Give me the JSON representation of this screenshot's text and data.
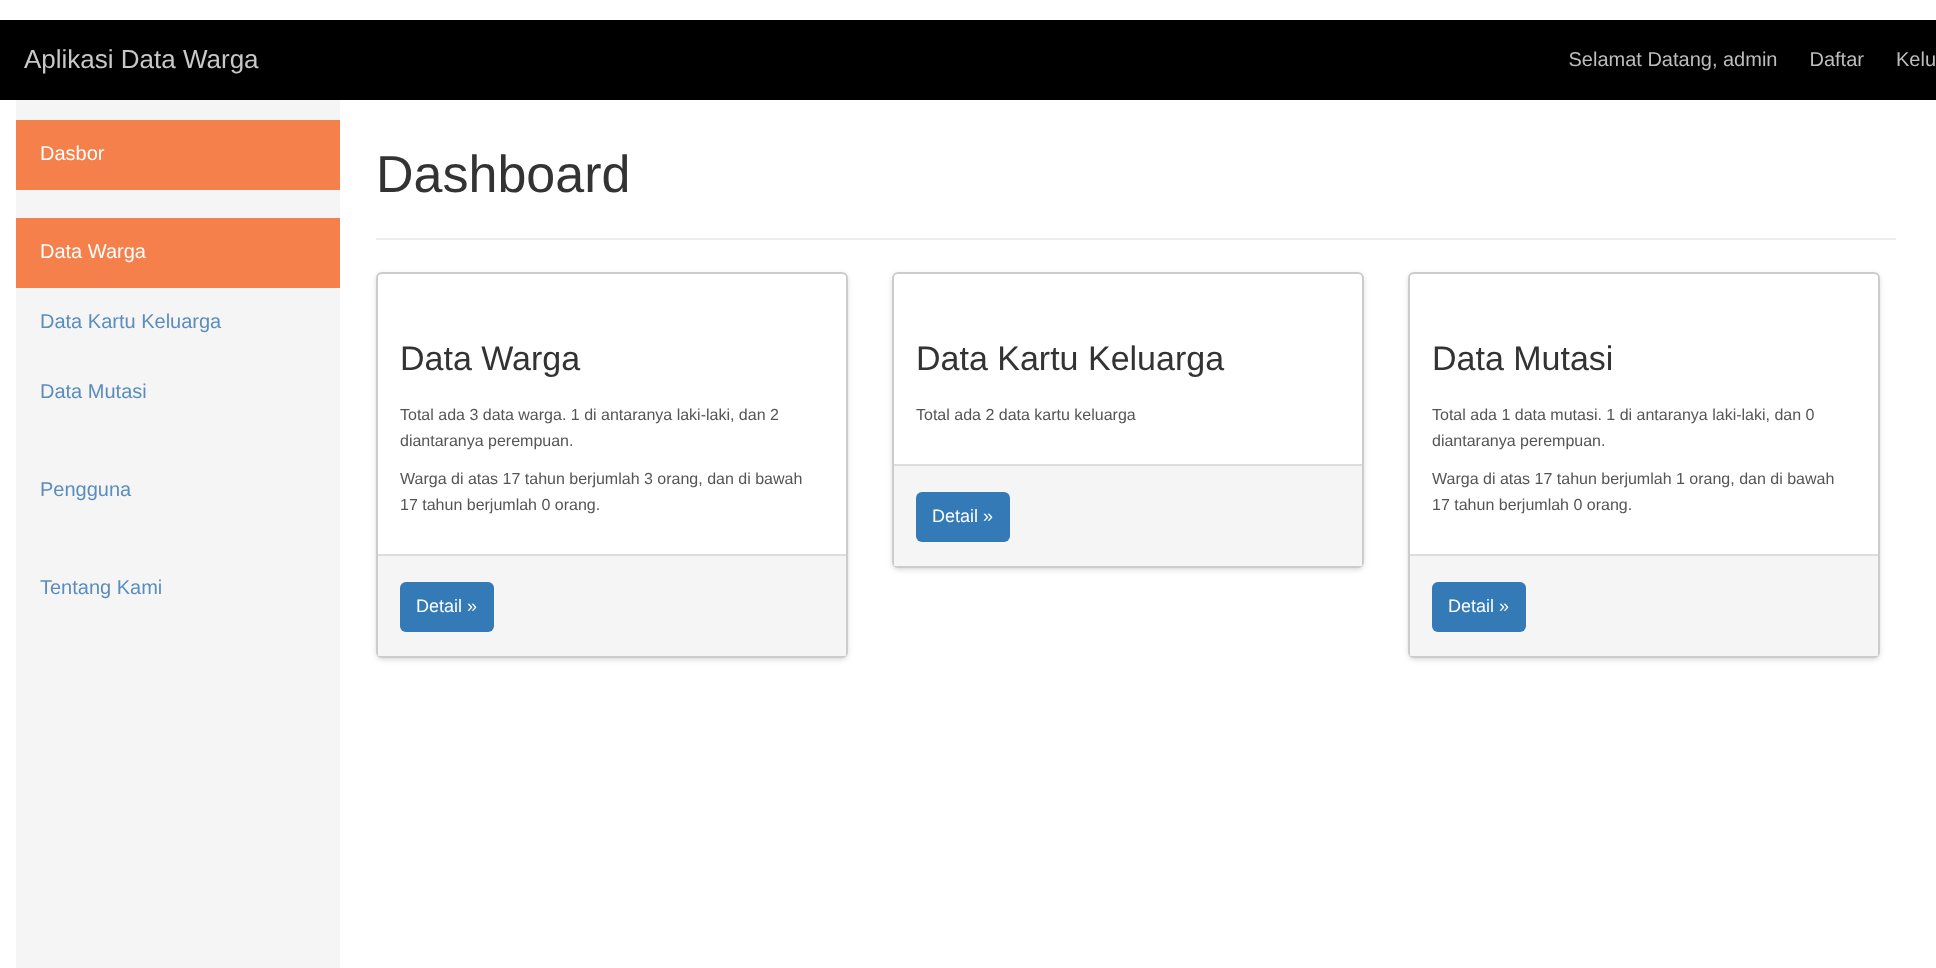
{
  "navbar": {
    "brand": "Aplikasi Data Warga",
    "links": [
      "Selamat Datang, admin",
      "Daftar",
      "Kelu"
    ]
  },
  "sidebar": {
    "groups": [
      {
        "items": [
          {
            "label": "Dasbor",
            "selected": true
          }
        ]
      },
      {
        "items": [
          {
            "label": "Data Warga",
            "selected": true
          },
          {
            "label": "Data Kartu Keluarga",
            "selected": false
          },
          {
            "label": "Data Mutasi",
            "selected": false
          }
        ]
      },
      {
        "items": [
          {
            "label": "Pengguna",
            "selected": false
          }
        ]
      },
      {
        "items": [
          {
            "label": "Tentang Kami",
            "selected": false
          }
        ]
      }
    ]
  },
  "page": {
    "title": "Dashboard"
  },
  "cards": [
    {
      "title": "Data Warga",
      "paragraphs": [
        "Total ada 3 data warga. 1 di antaranya laki-laki, dan 2 diantaranya perempuan.",
        "Warga di atas 17 tahun berjumlah 3 orang, dan di bawah 17 tahun berjumlah 0 orang."
      ],
      "button": "Detail »"
    },
    {
      "title": "Data Kartu Keluarga",
      "paragraphs": [
        "Total ada 2 data kartu keluarga"
      ],
      "button": "Detail »"
    },
    {
      "title": "Data Mutasi",
      "paragraphs": [
        "Total ada 1 data mutasi. 1 di antaranya laki-laki, dan 0 diantaranya perempuan.",
        "Warga di atas 17 tahun berjumlah 1 orang, dan di bawah 17 tahun berjumlah 0 orang."
      ],
      "button": "Detail »"
    }
  ]
}
